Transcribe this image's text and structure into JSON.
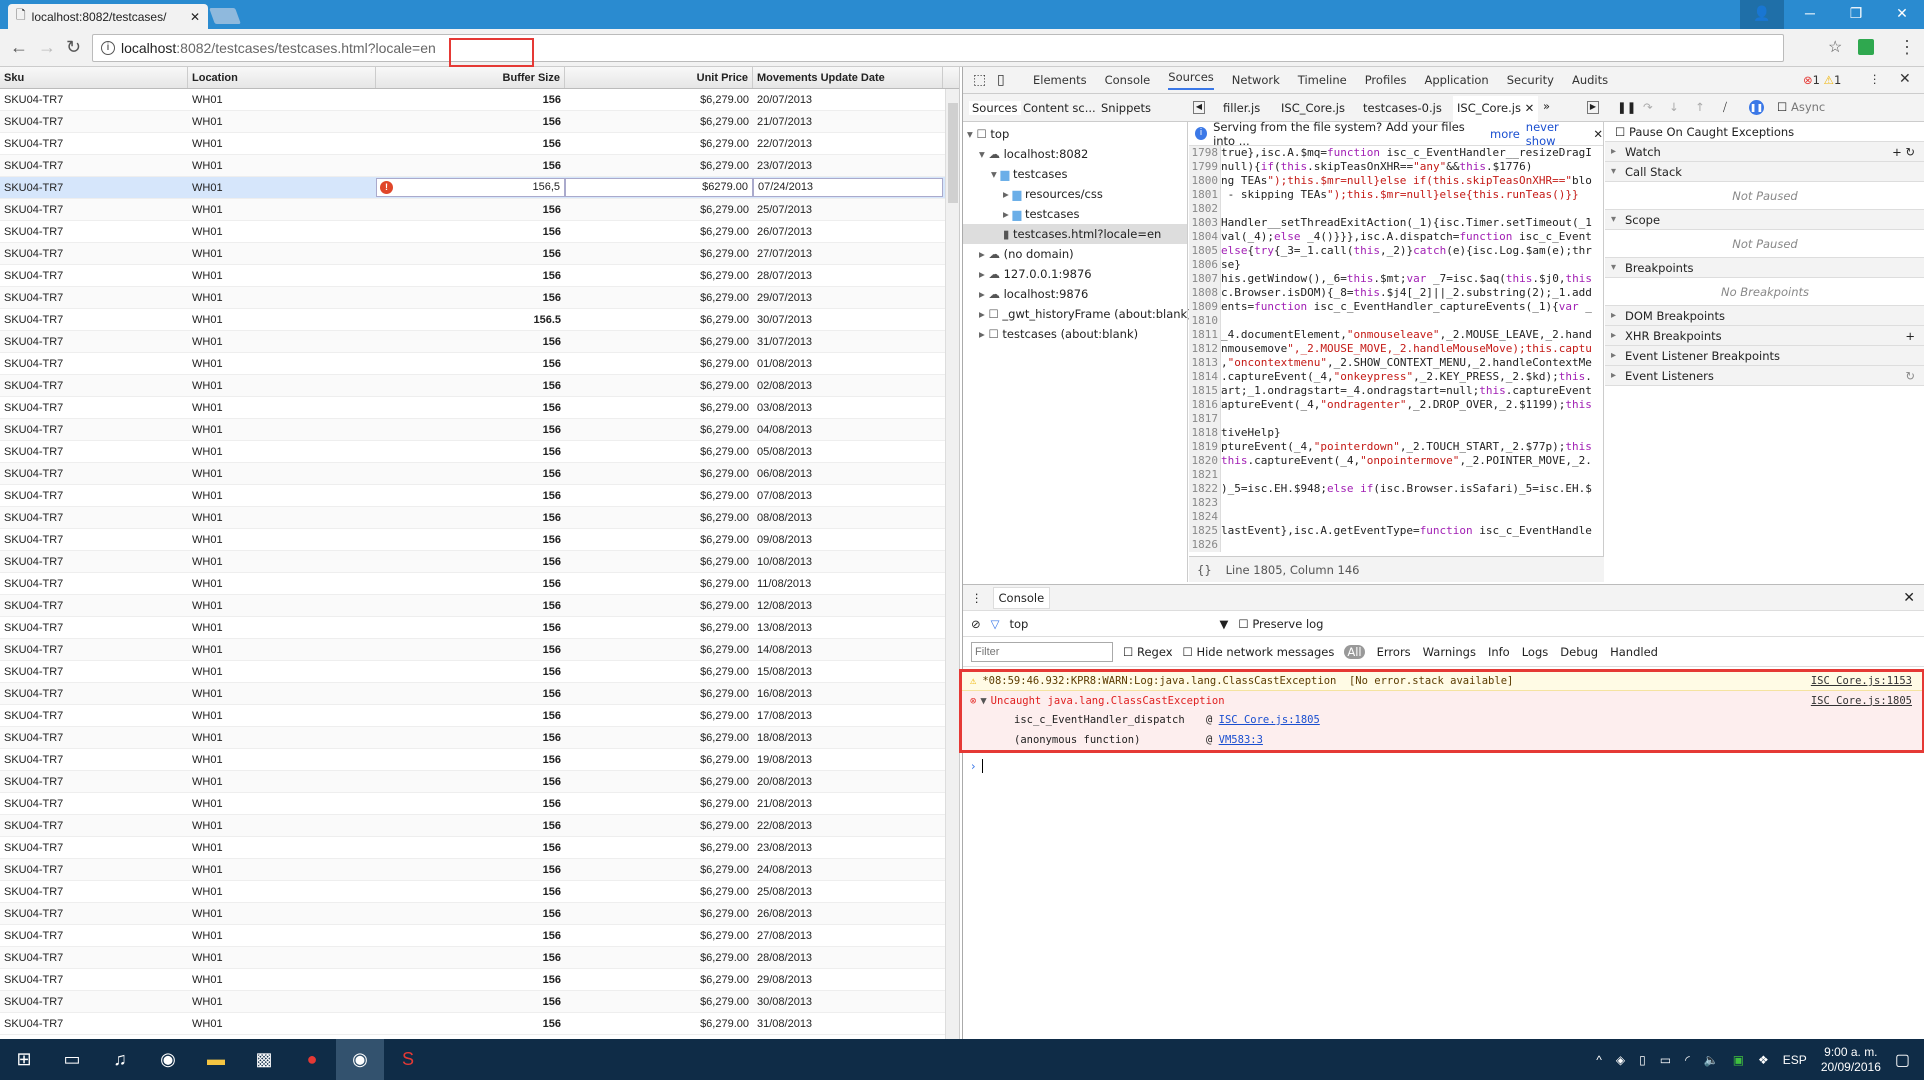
{
  "browser": {
    "tab_title": "localhost:8082/testcases/",
    "url_host": "localhost",
    "url_rest": ":8082/testcases/testcases.html?locale=en"
  },
  "grid": {
    "columns": [
      "Sku",
      "Location",
      "Buffer Size",
      "Unit Price",
      "Movements Update Date"
    ],
    "rows": [
      [
        "SKU04-TR7",
        "WH01",
        "156",
        "$6,279.00",
        "20/07/2013"
      ],
      [
        "SKU04-TR7",
        "WH01",
        "156",
        "$6,279.00",
        "21/07/2013"
      ],
      [
        "SKU04-TR7",
        "WH01",
        "156",
        "$6,279.00",
        "22/07/2013"
      ],
      [
        "SKU04-TR7",
        "WH01",
        "156",
        "$6,279.00",
        "23/07/2013"
      ],
      [
        "SKU04-TR7",
        "WH01",
        "156,5",
        "$6279.00",
        "07/24/2013"
      ],
      [
        "SKU04-TR7",
        "WH01",
        "156",
        "$6,279.00",
        "25/07/2013"
      ],
      [
        "SKU04-TR7",
        "WH01",
        "156",
        "$6,279.00",
        "26/07/2013"
      ],
      [
        "SKU04-TR7",
        "WH01",
        "156",
        "$6,279.00",
        "27/07/2013"
      ],
      [
        "SKU04-TR7",
        "WH01",
        "156",
        "$6,279.00",
        "28/07/2013"
      ],
      [
        "SKU04-TR7",
        "WH01",
        "156",
        "$6,279.00",
        "29/07/2013"
      ],
      [
        "SKU04-TR7",
        "WH01",
        "156.5",
        "$6,279.00",
        "30/07/2013"
      ],
      [
        "SKU04-TR7",
        "WH01",
        "156",
        "$6,279.00",
        "31/07/2013"
      ],
      [
        "SKU04-TR7",
        "WH01",
        "156",
        "$6,279.00",
        "01/08/2013"
      ],
      [
        "SKU04-TR7",
        "WH01",
        "156",
        "$6,279.00",
        "02/08/2013"
      ],
      [
        "SKU04-TR7",
        "WH01",
        "156",
        "$6,279.00",
        "03/08/2013"
      ],
      [
        "SKU04-TR7",
        "WH01",
        "156",
        "$6,279.00",
        "04/08/2013"
      ],
      [
        "SKU04-TR7",
        "WH01",
        "156",
        "$6,279.00",
        "05/08/2013"
      ],
      [
        "SKU04-TR7",
        "WH01",
        "156",
        "$6,279.00",
        "06/08/2013"
      ],
      [
        "SKU04-TR7",
        "WH01",
        "156",
        "$6,279.00",
        "07/08/2013"
      ],
      [
        "SKU04-TR7",
        "WH01",
        "156",
        "$6,279.00",
        "08/08/2013"
      ],
      [
        "SKU04-TR7",
        "WH01",
        "156",
        "$6,279.00",
        "09/08/2013"
      ],
      [
        "SKU04-TR7",
        "WH01",
        "156",
        "$6,279.00",
        "10/08/2013"
      ],
      [
        "SKU04-TR7",
        "WH01",
        "156",
        "$6,279.00",
        "11/08/2013"
      ],
      [
        "SKU04-TR7",
        "WH01",
        "156",
        "$6,279.00",
        "12/08/2013"
      ],
      [
        "SKU04-TR7",
        "WH01",
        "156",
        "$6,279.00",
        "13/08/2013"
      ],
      [
        "SKU04-TR7",
        "WH01",
        "156",
        "$6,279.00",
        "14/08/2013"
      ],
      [
        "SKU04-TR7",
        "WH01",
        "156",
        "$6,279.00",
        "15/08/2013"
      ],
      [
        "SKU04-TR7",
        "WH01",
        "156",
        "$6,279.00",
        "16/08/2013"
      ],
      [
        "SKU04-TR7",
        "WH01",
        "156",
        "$6,279.00",
        "17/08/2013"
      ],
      [
        "SKU04-TR7",
        "WH01",
        "156",
        "$6,279.00",
        "18/08/2013"
      ],
      [
        "SKU04-TR7",
        "WH01",
        "156",
        "$6,279.00",
        "19/08/2013"
      ],
      [
        "SKU04-TR7",
        "WH01",
        "156",
        "$6,279.00",
        "20/08/2013"
      ],
      [
        "SKU04-TR7",
        "WH01",
        "156",
        "$6,279.00",
        "21/08/2013"
      ],
      [
        "SKU04-TR7",
        "WH01",
        "156",
        "$6,279.00",
        "22/08/2013"
      ],
      [
        "SKU04-TR7",
        "WH01",
        "156",
        "$6,279.00",
        "23/08/2013"
      ],
      [
        "SKU04-TR7",
        "WH01",
        "156",
        "$6,279.00",
        "24/08/2013"
      ],
      [
        "SKU04-TR7",
        "WH01",
        "156",
        "$6,279.00",
        "25/08/2013"
      ],
      [
        "SKU04-TR7",
        "WH01",
        "156",
        "$6,279.00",
        "26/08/2013"
      ],
      [
        "SKU04-TR7",
        "WH01",
        "156",
        "$6,279.00",
        "27/08/2013"
      ],
      [
        "SKU04-TR7",
        "WH01",
        "156",
        "$6,279.00",
        "28/08/2013"
      ],
      [
        "SKU04-TR7",
        "WH01",
        "156",
        "$6,279.00",
        "29/08/2013"
      ],
      [
        "SKU04-TR7",
        "WH01",
        "156",
        "$6,279.00",
        "30/08/2013"
      ],
      [
        "SKU04-TR7",
        "WH01",
        "156",
        "$6,279.00",
        "31/08/2013"
      ]
    ],
    "editing_row": 4
  },
  "devtools": {
    "tabs": [
      "Elements",
      "Console",
      "Sources",
      "Network",
      "Timeline",
      "Profiles",
      "Application",
      "Security",
      "Audits"
    ],
    "active_tab": "Sources",
    "error_count": "1",
    "warning_count": "1",
    "nav_tabs": [
      "Sources",
      "Content sc...",
      "Snippets"
    ],
    "file_tabs": [
      "filler.js",
      "ISC_Core.js",
      "testcases-0.js",
      "ISC_Core.js"
    ],
    "async_label": "Async",
    "tree": [
      {
        "label": "top",
        "depth": 0,
        "icon": "frame"
      },
      {
        "label": "localhost:8082",
        "depth": 1,
        "icon": "cloud"
      },
      {
        "label": "testcases",
        "depth": 2,
        "icon": "folder"
      },
      {
        "label": "resources/css",
        "depth": 3,
        "icon": "folder"
      },
      {
        "label": "testcases",
        "depth": 3,
        "icon": "folder"
      },
      {
        "label": "testcases.html?locale=en",
        "depth": 3,
        "icon": "file"
      },
      {
        "label": "(no domain)",
        "depth": 1,
        "icon": "cloud"
      },
      {
        "label": "127.0.0.1:9876",
        "depth": 1,
        "icon": "cloud"
      },
      {
        "label": "localhost:9876",
        "depth": 1,
        "icon": "cloud"
      },
      {
        "label": "_gwt_historyFrame (about:blank)",
        "depth": 1,
        "icon": "frame"
      },
      {
        "label": "testcases (about:blank)",
        "depth": 1,
        "icon": "frame"
      }
    ],
    "info_bar": {
      "text": "Serving from the file system? Add your files into ...",
      "more": "more",
      "never_show": "never show"
    },
    "code": [
      [
        "1798",
        "true},isc.A.$mq=function isc_c_EventHandler__resizeDragI"
      ],
      [
        "1799",
        "null){if(this.skipTeasOnXHR==\"any\"&&this.$1776)"
      ],
      [
        "1800",
        "ng TEAs\");this.$mr=null}else if(this.skipTeasOnXHR==\"blo"
      ],
      [
        "1801",
        " - skipping TEAs\");this.$mr=null}else{this.runTeas()}}"
      ],
      [
        "1802",
        ""
      ],
      [
        "1803",
        "Handler__setThreadExitAction(_1){isc.Timer.setTimeout(_1"
      ],
      [
        "1804",
        "val(_4);else _4()}}},isc.A.dispatch=function isc_c_Event"
      ],
      [
        "1805",
        "else{try{_3=_1.call(this,_2)}catch(e){isc.Log.$am(e);thr"
      ],
      [
        "1806",
        "se}"
      ],
      [
        "1807",
        "his.getWindow(),_6=this.$mt;var _7=isc.$aq(this.$j0,this"
      ],
      [
        "1808",
        "c.Browser.isDOM){_8=this.$j4[_2]||_2.substring(2);_1.add"
      ],
      [
        "1809",
        "ents=function isc_c_EventHandler_captureEvents(_1){var _"
      ],
      [
        "1810",
        ""
      ],
      [
        "1811",
        "_4.documentElement,\"onmouseleave\",_2.MOUSE_LEAVE,_2.hand"
      ],
      [
        "1812",
        "nmousemove\",_2.MOUSE_MOVE,_2.handleMouseMove);this.captu"
      ],
      [
        "1813",
        ",\"oncontextmenu\",_2.SHOW_CONTEXT_MENU,_2.handleContextMe"
      ],
      [
        "1814",
        ".captureEvent(_4,\"onkeypress\",_2.KEY_PRESS,_2.$kd);this."
      ],
      [
        "1815",
        "art;_1.ondragstart=_4.ondragstart=null;this.captureEvent"
      ],
      [
        "1816",
        "aptureEvent(_4,\"ondragenter\",_2.DROP_OVER,_2.$1199);this"
      ],
      [
        "1817",
        ""
      ],
      [
        "1818",
        "tiveHelp}"
      ],
      [
        "1819",
        "ptureEvent(_4,\"pointerdown\",_2.TOUCH_START,_2.$77p);this"
      ],
      [
        "1820",
        "this.captureEvent(_4,\"onpointermove\",_2.POINTER_MOVE,_2."
      ],
      [
        "1821",
        ""
      ],
      [
        "1822",
        ")_5=isc.EH.$948;else if(isc.Browser.isSafari)_5=isc.EH.$"
      ],
      [
        "1823",
        ""
      ],
      [
        "1824",
        ""
      ],
      [
        "1825",
        "lastEvent},isc.A.getEventType=function isc_c_EventHandle"
      ],
      [
        "1826",
        ""
      ]
    ],
    "status": "Line 1805, Column 146",
    "sidebar": {
      "pause_caught": "Pause On Caught Exceptions",
      "watch": "Watch",
      "call_stack": "Call Stack",
      "not_paused": "Not Paused",
      "scope": "Scope",
      "scope_not_paused": "Not Paused",
      "breakpoints": "Breakpoints",
      "no_breakpoints": "No Breakpoints",
      "dom_bp": "DOM Breakpoints",
      "xhr_bp": "XHR Breakpoints",
      "event_bp": "Event Listener Breakpoints",
      "event_listeners": "Event Listeners"
    },
    "console": {
      "tab": "Console",
      "context": "top",
      "preserve_log": "Preserve log",
      "filter_placeholder": "Filter",
      "regex": "Regex",
      "hide_network": "Hide network messages",
      "levels": [
        "All",
        "Errors",
        "Warnings",
        "Info",
        "Logs",
        "Debug",
        "Handled"
      ],
      "warn": {
        "text": "*08:59:46.932:KPR8:WARN:Log:java.lang.ClassCastException  [No error.stack available]",
        "source": "ISC Core.js:1153"
      },
      "error": {
        "text": "Uncaught java.lang.ClassCastException",
        "source": "ISC Core.js:1805",
        "stack": [
          {
            "fn": "isc_c_EventHandler_dispatch",
            "at": "@",
            "link": "ISC Core.js:1805"
          },
          {
            "fn": "(anonymous function)",
            "at": "@",
            "link": "VM583:3"
          }
        ]
      }
    }
  },
  "taskbar": {
    "lang": "ESP",
    "time": "9:00 a. m.",
    "date": "20/09/2016"
  },
  "colors": {
    "chrome_blue": "#2a8bd0",
    "highlight_red": "#e53935",
    "taskbar": "#0f2c47",
    "selected_row": "#d6e6fb"
  }
}
